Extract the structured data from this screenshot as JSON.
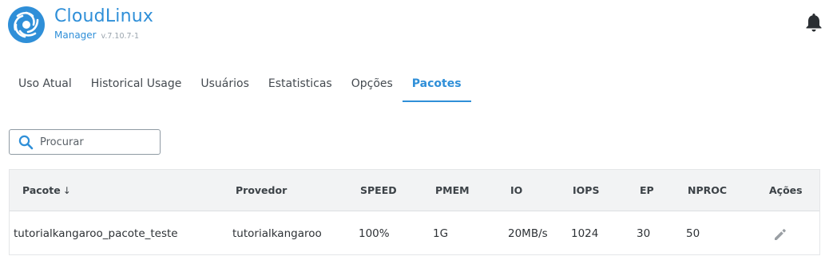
{
  "header": {
    "brand_name": "CloudLinux",
    "product_name": "Manager",
    "version": "v.7.10.7-1",
    "notifications_icon": "bell-icon",
    "brand_color": "#2f8fd8"
  },
  "tabs": [
    {
      "label": "Uso Atual",
      "active": false
    },
    {
      "label": "Historical Usage",
      "active": false
    },
    {
      "label": "Usuários",
      "active": false
    },
    {
      "label": "Estatisticas",
      "active": false
    },
    {
      "label": "Opções",
      "active": false
    },
    {
      "label": "Pacotes",
      "active": true
    }
  ],
  "search": {
    "placeholder": "Procurar",
    "value": "",
    "icon": "search-icon"
  },
  "table": {
    "columns": [
      "Pacote",
      "Provedor",
      "SPEED",
      "PMEM",
      "IO",
      "IOPS",
      "EP",
      "NPROC",
      "Ações"
    ],
    "sort_indicator": "↓",
    "rows": [
      {
        "pacote": "tutorialkangaroo_pacote_teste",
        "provedor": "tutorialkangaroo",
        "speed": "100%",
        "pmem": "1G",
        "io": "20MB/s",
        "iops": "1024",
        "ep": "30",
        "nproc": "50",
        "action_icon": "pencil-icon"
      }
    ]
  }
}
